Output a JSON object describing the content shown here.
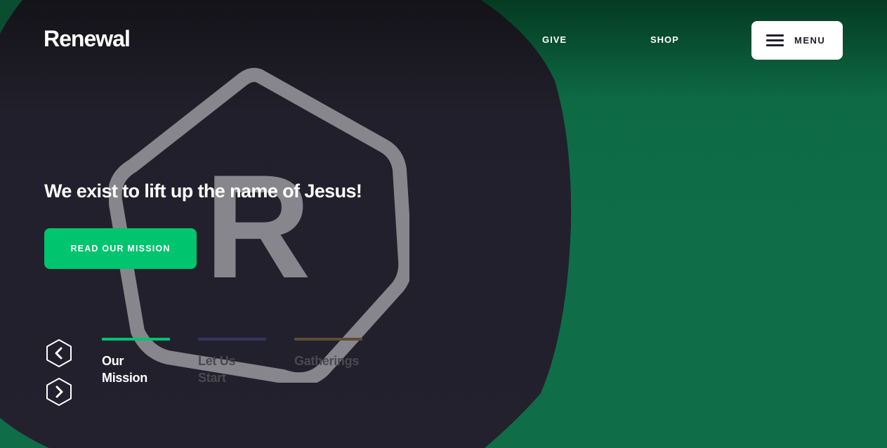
{
  "brand": {
    "name": "Renewal"
  },
  "nav": {
    "give": "GIVE",
    "shop": "SHOP",
    "menu_label": "MENU"
  },
  "hero": {
    "headline": "We exist to lift up the name of Jesus!",
    "cta_label": "READ OUR MISSION"
  },
  "slider": {
    "prev_icon": "chevron-left-icon",
    "next_icon": "chevron-right-icon",
    "tabs": [
      {
        "label": "Our Mission",
        "active": true,
        "color": "#00c46e"
      },
      {
        "label": "Let Us Start",
        "active": false,
        "color": "#36335e"
      },
      {
        "label": "Gatherings",
        "active": false,
        "color": "#5e4d34"
      }
    ]
  },
  "colors": {
    "accent": "#00c46e",
    "dark_panel": "#222030",
    "green_background": "#0f6d47",
    "logo_mark": "#8a898f"
  },
  "background": {
    "logo_letter": "R"
  }
}
